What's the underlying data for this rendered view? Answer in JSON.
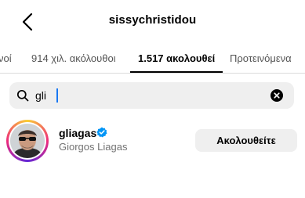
{
  "header": {
    "title": "sissychristidou",
    "back_icon": "chevron-left-icon"
  },
  "tabs": [
    {
      "label": "νοί",
      "active": false
    },
    {
      "label": "914 χιλ. ακόλουθοι",
      "active": false
    },
    {
      "label": "1.517 ακολουθεί",
      "active": true
    },
    {
      "label": "Προτεινόμενα",
      "active": false
    }
  ],
  "search": {
    "value": "gli",
    "search_icon": "search-icon",
    "clear_icon": "clear-icon"
  },
  "results": [
    {
      "username": "gliagas",
      "verified": true,
      "full_name": "Giorgos Liagas",
      "button_label": "Ακολουθείτε"
    }
  ],
  "colors": {
    "verified_badge": "#0095f6",
    "caret": "#1877f2",
    "secondary_text": "#737373",
    "search_bg": "#efefef"
  }
}
